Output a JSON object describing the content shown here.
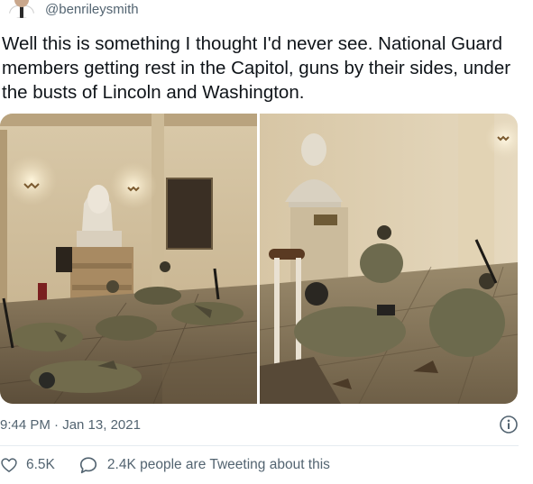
{
  "author": {
    "handle": "@benrileysmith"
  },
  "tweet": {
    "text": "Well this is something I thought I'd never see. National Guard members getting rest in the Capitol, guns by their sides, under the busts of Lincoln and Washington."
  },
  "meta": {
    "timestamp": "9:44 PM · Jan 13, 2021"
  },
  "actions": {
    "likes_count": "6.5K",
    "tweeting_text": "2.4K people are Tweeting about this"
  },
  "icons": {
    "avatar": "user-avatar",
    "info": "info-icon",
    "like": "heart-icon",
    "reply": "speech-bubble-icon"
  },
  "colors": {
    "text": "#0f1419",
    "secondary": "#536471",
    "divider": "#e6ecf0"
  }
}
